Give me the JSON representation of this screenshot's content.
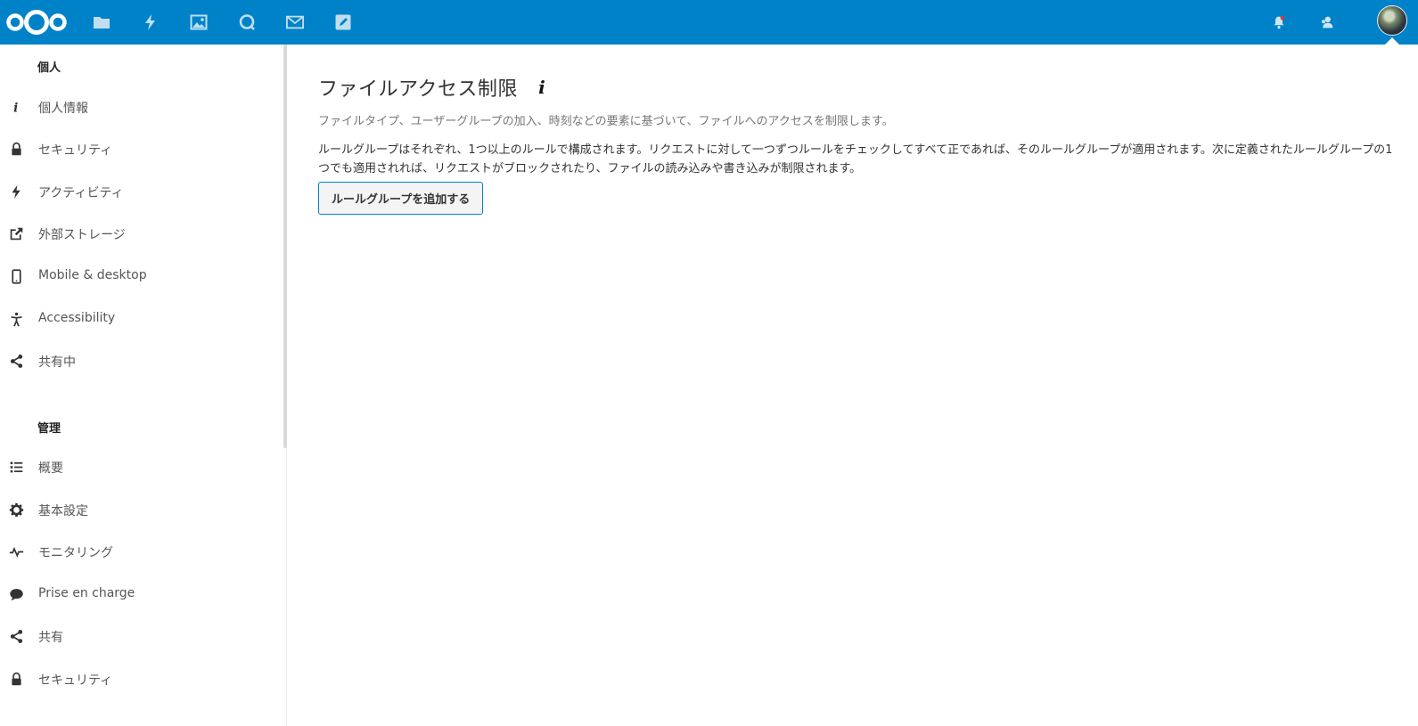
{
  "colors": {
    "header": "#0082c9",
    "accent": "#0082c9"
  },
  "header": {
    "logo_icon": "nextcloud-logo-icon",
    "apps": [
      {
        "name": "files",
        "icon": "folder-icon"
      },
      {
        "name": "activity",
        "icon": "lightning-icon"
      },
      {
        "name": "gallery",
        "icon": "image-icon"
      },
      {
        "name": "talk",
        "icon": "chat-bubble-icon"
      },
      {
        "name": "mail",
        "icon": "mail-icon"
      },
      {
        "name": "notes",
        "icon": "edit-icon"
      }
    ],
    "right_icons": [
      "notifications-bell-icon",
      "contacts-icon"
    ],
    "avatar": "user-avatar"
  },
  "sidebar": {
    "personal_heading": "個人",
    "personal_items": [
      {
        "label": "個人情報",
        "icon": "info-icon"
      },
      {
        "label": "セキュリティ",
        "icon": "lock-icon"
      },
      {
        "label": "アクティビティ",
        "icon": "lightning-icon"
      },
      {
        "label": "外部ストレージ",
        "icon": "external-link-icon"
      },
      {
        "label": "Mobile & desktop",
        "icon": "phone-icon"
      },
      {
        "label": "Accessibility",
        "icon": "accessibility-icon"
      },
      {
        "label": "共有中",
        "icon": "share-icon"
      }
    ],
    "admin_heading": "管理",
    "admin_items": [
      {
        "label": "概要",
        "icon": "list-icon"
      },
      {
        "label": "基本設定",
        "icon": "gear-icon"
      },
      {
        "label": "モニタリング",
        "icon": "pulse-icon"
      },
      {
        "label": "Prise en charge",
        "icon": "speech-bubble-icon"
      },
      {
        "label": "共有",
        "icon": "share-icon"
      },
      {
        "label": "セキュリティ",
        "icon": "lock-icon"
      }
    ]
  },
  "main": {
    "title": "ファイルアクセス制限",
    "description": "ファイルタイプ、ユーザーグループの加入、時刻などの要素に基づいて、ファイルへのアクセスを制限します。",
    "paragraph": "ルールグループはそれぞれ、1つ以上のルールで構成されます。リクエストに対して一つずつルールをチェックしてすべて正であれば、そのルールグループが適用されます。次に定義されたルールグループの1つでも適用されれば、リクエストがブロックされたり、ファイルの読み込みや書き込みが制限されます。",
    "add_button": "ルールグループを追加する"
  }
}
